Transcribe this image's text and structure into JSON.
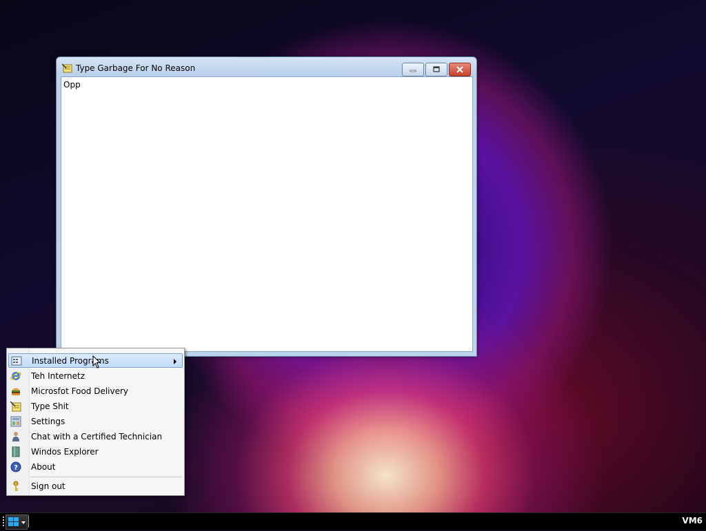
{
  "window": {
    "title": "Type Garbage For No Reason",
    "content_text": "Opp",
    "icon": "notepad-icon"
  },
  "start_menu": {
    "items": [
      {
        "label": "Installed Programs",
        "icon": "programs-icon",
        "has_submenu": true,
        "highlighted": true
      },
      {
        "label": "Teh Internetz",
        "icon": "internet-explorer-icon"
      },
      {
        "label": "Microsfot Food Delivery",
        "icon": "burger-icon"
      },
      {
        "label": "Type Shit",
        "icon": "notepad-icon"
      },
      {
        "label": "Settings",
        "icon": "settings-icon"
      },
      {
        "label": "Chat with a Certified Technician",
        "icon": "technician-icon"
      },
      {
        "label": "Windos Explorer",
        "icon": "explorer-icon"
      },
      {
        "label": "About",
        "icon": "help-icon"
      },
      {
        "label": "Sign out",
        "icon": "key-icon"
      }
    ]
  },
  "taskbar": {
    "start_icon": "windows-logo-icon",
    "tray_label": "VM6"
  },
  "colors": {
    "taskbar": "#000000",
    "menu_highlight": "#c1dcfa",
    "close_button": "#c8402a"
  }
}
